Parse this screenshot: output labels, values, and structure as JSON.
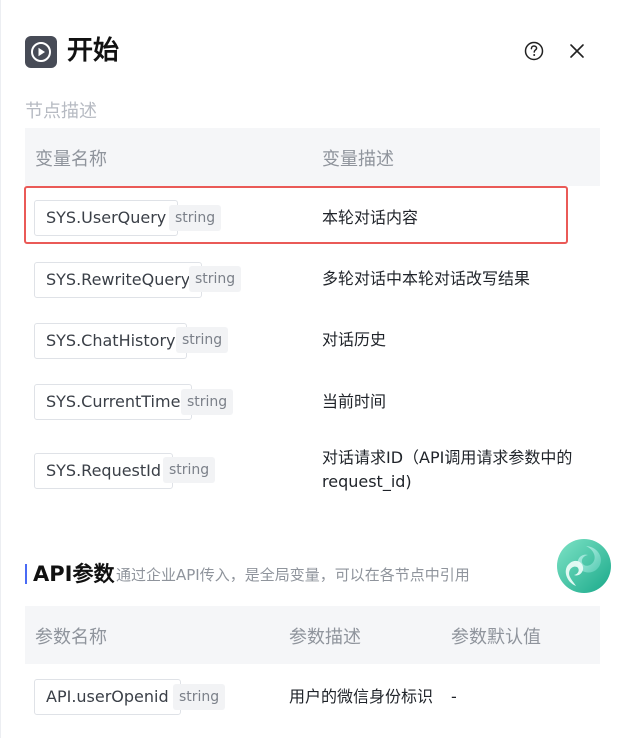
{
  "header": {
    "title": "开始"
  },
  "node_section": {
    "label": "节点描述",
    "columns": [
      "变量名称",
      "变量描述"
    ],
    "rows": [
      {
        "name": "SYS.UserQuery",
        "type": "string",
        "desc": "本轮对话内容"
      },
      {
        "name": "SYS.RewriteQuery",
        "type": "string",
        "desc": "多轮对话中本轮对话改写结果"
      },
      {
        "name": "SYS.ChatHistory",
        "type": "string",
        "desc": "对话历史"
      },
      {
        "name": "SYS.CurrentTime",
        "type": "string",
        "desc": "当前时间"
      },
      {
        "name": "SYS.RequestId",
        "type": "string",
        "desc_line1": "对话请求ID（API调用请求参数中的",
        "desc_line2": "request_id)"
      }
    ]
  },
  "api_section": {
    "title": "API参数",
    "subtitle": "通过企业API传入，是全局变量，可以在各节点中引用",
    "columns": [
      "参数名称",
      "参数描述",
      "参数默认值"
    ],
    "rows": [
      {
        "name": "API.userOpenid",
        "type": "string",
        "desc": "用户的微信身份标识",
        "default": "-"
      }
    ]
  },
  "colors": {
    "highlight": "#ea5a57",
    "accent": "#4a6bf5"
  },
  "icons": {
    "start": "play-icon",
    "help": "help-icon",
    "close": "close-icon",
    "assistant": "assistant-logo-icon"
  }
}
